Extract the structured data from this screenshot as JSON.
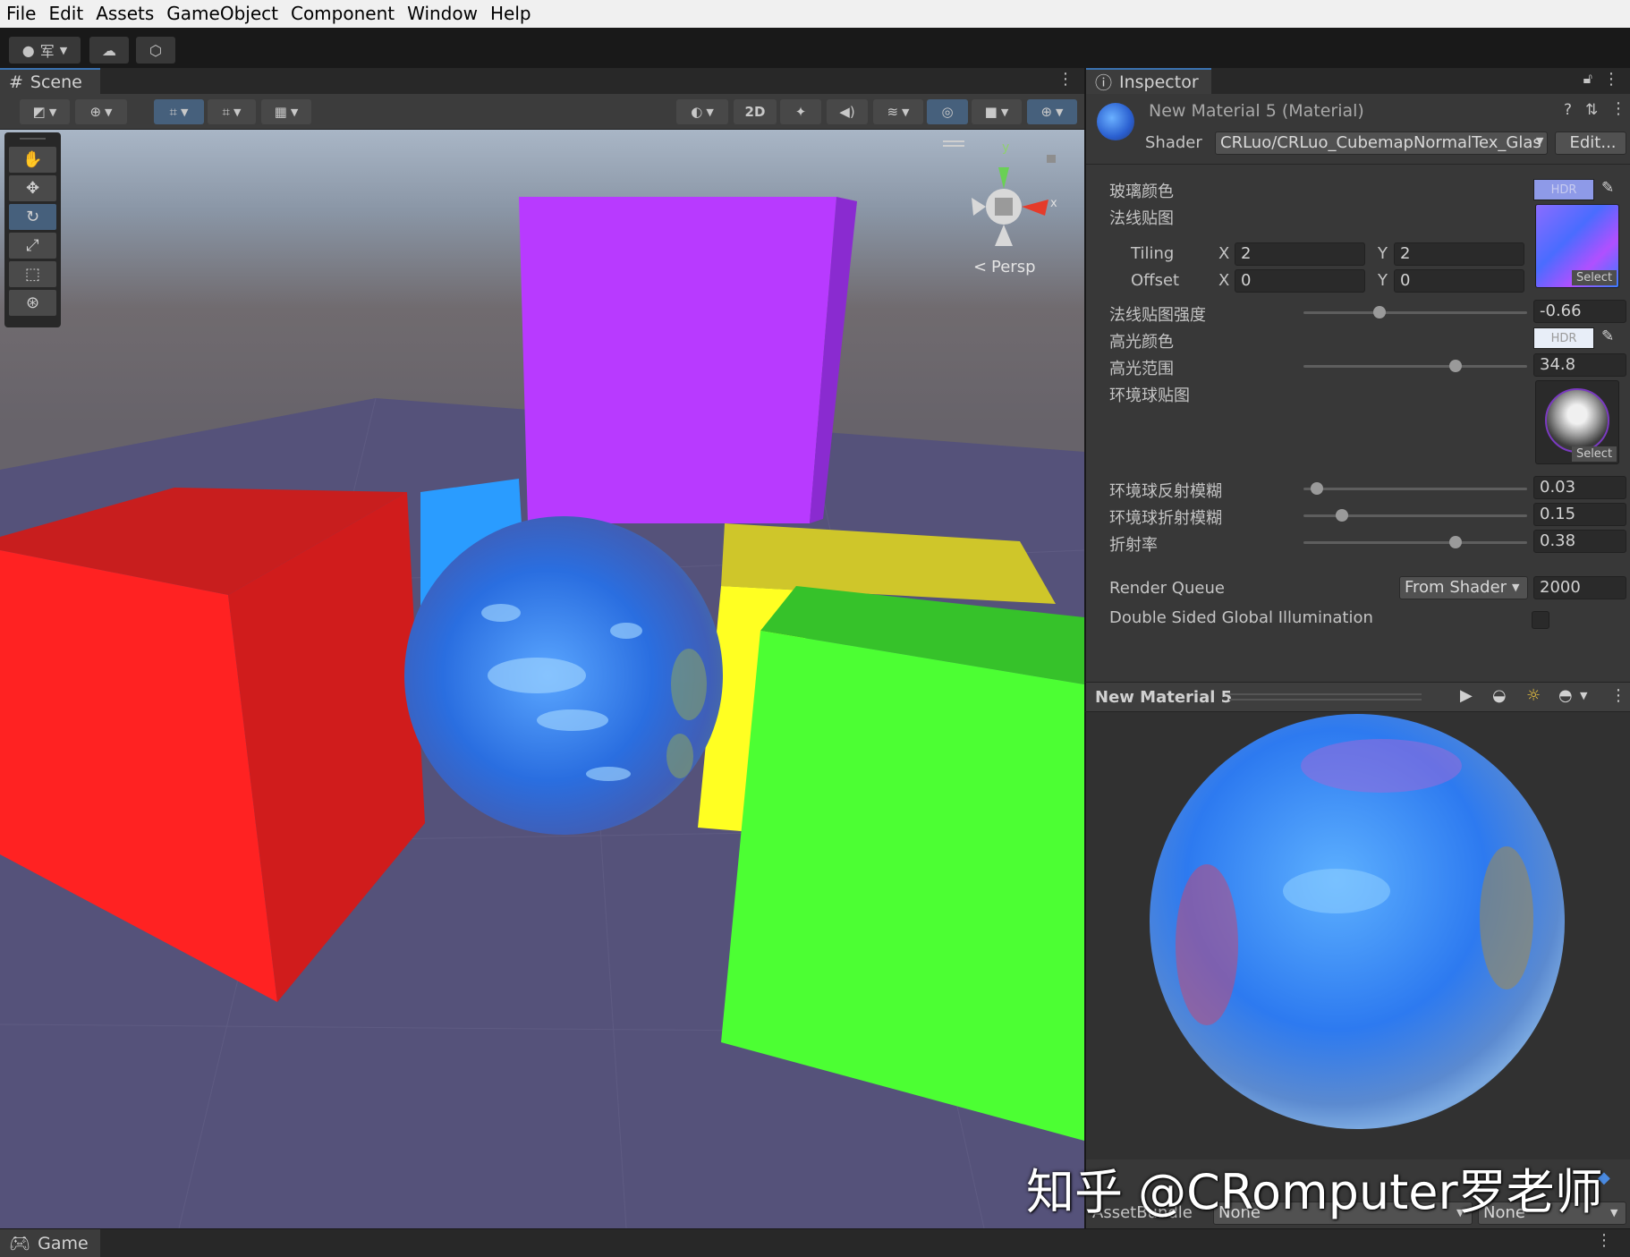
{
  "menu": [
    "File",
    "Edit",
    "Assets",
    "GameObject",
    "Component",
    "Window",
    "Help"
  ],
  "toolbar": {
    "account_icon": "account-icon",
    "layers_label": "军",
    "cloud_icon": "cloud-icon",
    "collab_icon": "collab-icon"
  },
  "scene": {
    "tab_label": "Scene",
    "toolbar_2d": "2D",
    "persp_label": "Persp",
    "gizmo_y": "y",
    "gizmo_x": "x"
  },
  "inspector": {
    "tab_label": "Inspector",
    "material_title": "New Material 5 (Material)",
    "shader_label": "Shader",
    "shader_value": "CRLuo/CRLuo_CubemapNormalTex_Glas",
    "edit_button": "Edit...",
    "hdr_label": "HDR",
    "select_label": "Select",
    "props": {
      "glass_color": "玻璃颜色",
      "normal_map": "法线贴图",
      "tiling": "Tiling",
      "offset": "Offset",
      "x": "X",
      "y": "Y",
      "tiling_x": "2",
      "tiling_y": "2",
      "offset_x": "0",
      "offset_y": "0",
      "normal_strength": "法线贴图强度",
      "normal_strength_value": "-0.66",
      "spec_color": "高光颜色",
      "spec_range": "高光范围",
      "spec_range_value": "34.8",
      "env_map": "环境球贴图",
      "env_reflect_blur": "环境球反射模糊",
      "env_reflect_blur_value": "0.03",
      "env_refract_blur": "环境球折射模糊",
      "env_refract_blur_value": "0.15",
      "refraction": "折射率",
      "refraction_value": "0.38",
      "render_queue": "Render Queue",
      "render_queue_mode": "From Shader",
      "render_queue_value": "2000",
      "double_sided_gi": "Double Sided Global Illumination"
    },
    "slider_fractions": {
      "normal_strength": 0.34,
      "spec_range": 0.68,
      "env_reflect_blur": 0.06,
      "env_refract_blur": 0.17,
      "refraction": 0.68
    },
    "preview_title": "New Material 5",
    "assetbundle_label": "AssetBundle",
    "assetbundle_value": "None",
    "assetbundle_variant": "None"
  },
  "game": {
    "tab_label": "Game"
  },
  "watermark": "知乎 @CRomputer罗老师",
  "colors": {
    "red_cube": "#ff2222",
    "green_cube": "#4cff33",
    "yellow_cube": "#ffff22",
    "purple_cube": "#bb33ff",
    "blue_cube": "#2299ff",
    "selection": "#46607c"
  }
}
